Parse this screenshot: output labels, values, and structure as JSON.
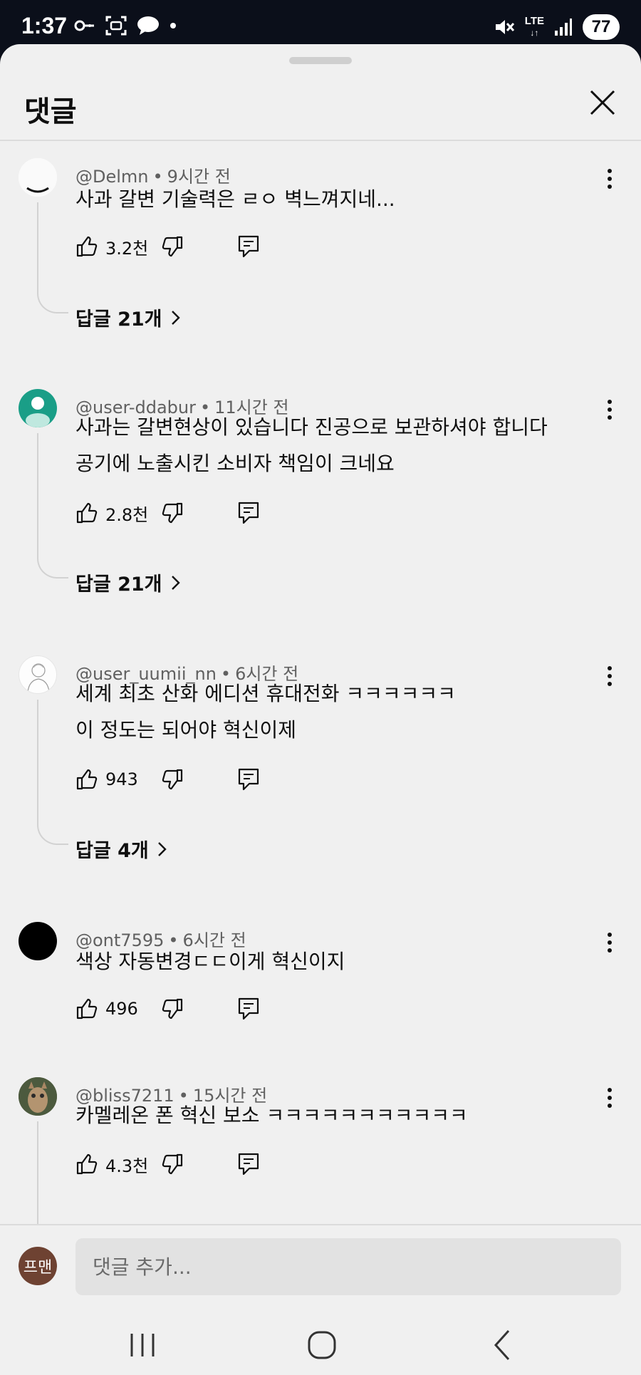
{
  "status_bar": {
    "time": "1:37",
    "network": "LTE",
    "battery": "77"
  },
  "sheet": {
    "title": "댓글"
  },
  "comments": [
    {
      "handle": "@Delmn",
      "time": "9시간 전",
      "text": [
        "사과 갈변 기술력은 ㄹㅇ 벽느껴지네..."
      ],
      "likes": "3.2천",
      "replies": "답글 21개",
      "avatar": "white-avatar"
    },
    {
      "handle": "@user-ddabur",
      "time": "11시간 전",
      "text": [
        "사과는 갈변현상이 있습니다 진공으로 보관하셔야 합니다",
        "공기에 노출시킨 소비자 책임이 크네요"
      ],
      "likes": "2.8천",
      "replies": "답글 21개",
      "avatar": "teal-person-avatar"
    },
    {
      "handle": "@user_uumii_nn",
      "time": "6시간 전",
      "text": [
        "세계 최초 산화 에디션 휴대전화 ㅋㅋㅋㅋㅋㅋ",
        "이 정도는 되어야 혁신이제"
      ],
      "likes": "943",
      "replies": "답글 4개",
      "avatar": "sketch-avatar"
    },
    {
      "handle": "@ont7595",
      "time": "6시간 전",
      "text": [
        "색상 자동변경ㄷㄷ이게 혁신이지"
      ],
      "likes": "496",
      "replies": "",
      "avatar": "black-avatar"
    },
    {
      "handle": "@bliss7211",
      "time": "15시간 전",
      "text": [
        "카멜레온 폰 혁신 보소 ㅋㅋㅋㅋㅋㅋㅋㅋㅋㅋㅋ"
      ],
      "likes": "4.3천",
      "replies": "",
      "avatar": "cat-avatar"
    }
  ],
  "composer": {
    "avatar_text": "프맨",
    "placeholder": "댓글 추가..."
  },
  "colors": {
    "sheet_bg": "#f0f0f0",
    "status_bg": "#0b0f1a",
    "text": "#0f0f0f",
    "meta": "#606060",
    "teal": "#1a9e87"
  }
}
